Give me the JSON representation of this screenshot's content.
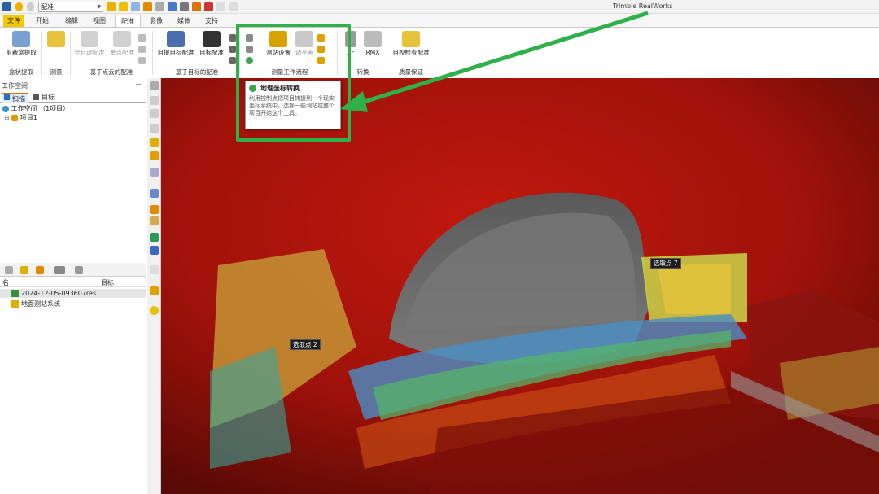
{
  "title_bar": {
    "quick_combo": "配准",
    "app_title": "Trimble RealWorks"
  },
  "tabs": [
    {
      "label": "文件"
    },
    {
      "label": "开始"
    },
    {
      "label": "编辑"
    },
    {
      "label": "视图"
    },
    {
      "label": "配准"
    },
    {
      "label": "影像"
    },
    {
      "label": "媒体"
    },
    {
      "label": "支持"
    }
  ],
  "ribbon": {
    "groups": [
      {
        "label": "盒状提取",
        "buttons": [
          "剪裁盒提取"
        ]
      },
      {
        "label": "测量",
        "buttons": [
          "测量"
        ]
      },
      {
        "label": "基于点云的配准",
        "buttons": [
          "全自动配准",
          "单点配准"
        ]
      },
      {
        "label": "基于目标的配准",
        "buttons": [
          "自提目标配准",
          "目标配准"
        ]
      },
      {
        "label": "测量工作流程",
        "buttons": [
          "测站设置",
          "调平差"
        ]
      },
      {
        "label": "转换",
        "buttons": [
          "ZF",
          "RMX"
        ]
      },
      {
        "label": "质量保证",
        "buttons": [
          "目视检查配准"
        ]
      }
    ]
  },
  "tooltip": {
    "title": "地理坐标转换",
    "body": "利用控制点把项目转换到一个现实坐标系统中。选择一些测站或整个项目开始这个工具。"
  },
  "left_panel": {
    "header": "工作空间",
    "tabs": [
      "扫描",
      "目标"
    ],
    "tree": [
      {
        "label": "工作空间 （1项目）"
      },
      {
        "label": "项目1"
      }
    ],
    "list_headers": [
      "名",
      "目标"
    ],
    "list_rows": [
      {
        "label": "2024-12-05-093607res..."
      },
      {
        "label": "地面测站系统"
      }
    ]
  },
  "viewport": {
    "labels": [
      "选取点 7",
      "选取点 2"
    ]
  },
  "colors": {
    "highlight": "#2fb04a",
    "file_tab": "#f5c900",
    "scan_red": "#b3140c"
  }
}
